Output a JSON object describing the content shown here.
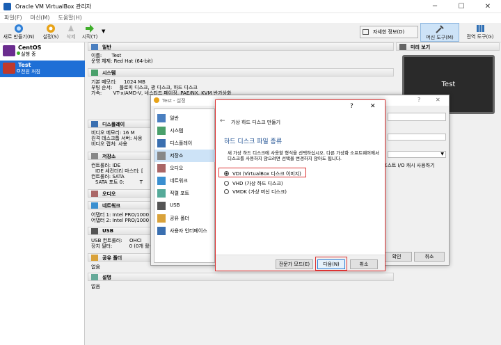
{
  "window": {
    "title": "Oracle VM VirtualBox 관리자"
  },
  "menu": [
    "파일(F)",
    "머신(M)",
    "도움말(H)"
  ],
  "toolbar": {
    "new": "새로 만들기(N)",
    "settings": "설정(S)",
    "discard": "삭제",
    "start": "시작(T)",
    "details": "자세한 정보(D)",
    "machine_tools": "머신 도구(M)",
    "global_tools": "전역 도구(G)"
  },
  "vms": [
    {
      "name": "CentOS",
      "state": "실행 중"
    },
    {
      "name": "Test",
      "state": "전원 꺼짐"
    }
  ],
  "sections": {
    "general": "일반",
    "system": "시스템",
    "display": "디스플레이",
    "storage": "저장소",
    "audio": "오디오",
    "network": "네트워크",
    "usb": "USB",
    "shared": "공유 폴더",
    "desc": "설명",
    "preview": "미리 보기"
  },
  "general": {
    "name_l": "이름:",
    "name_v": "Test",
    "os_l": "운영 체제:",
    "os_v": "Red Hat (64-bit)"
  },
  "system": {
    "r1": "기본 메모리:",
    "r1v": "1024 MB",
    "r2": "부팅 순서:",
    "r2v": "플로피 디스크, 광 디스크, 하드 디스크",
    "r3": "가속:",
    "r3v": "VT-x/AMD-V, 네스티드 페이징, PAE/NX, KVM 반가상화"
  },
  "display": {
    "r1": "비디오 메모리:",
    "r1v": "16 M",
    "r2": "원격 데스크톱 서버:",
    "r2v": "사용",
    "r3": "비디오 캡처:",
    "r3v": "사용"
  },
  "storage": {
    "r1": "컨트롤러: IDE",
    "r2": "IDE 세컨더리 마스터:",
    "r2v": "[",
    "r3": "컨트롤러: SATA",
    "r4": "SATA 포트 0:",
    "r4v": "T"
  },
  "network": {
    "r1": "어댑터 1:",
    "r1v": "Intel PRO/1000",
    "r2": "어댑터 2:",
    "r2v": "Intel PRO/1000"
  },
  "usb": {
    "r1": "USB 컨트롤러:",
    "r1v": "OHCI",
    "r2": "장치 필터:",
    "r2v": "0 (0개 활성"
  },
  "shared": {
    "v": "없음"
  },
  "desc": {
    "v": "없음"
  },
  "preview": {
    "label": "Test"
  },
  "settings_dialog": {
    "title": "Test - 설정",
    "items": [
      "일반",
      "시스템",
      "디스플레이",
      "저장소",
      "오디오",
      "네트워크",
      "직렬 포트",
      "USB",
      "공유 폴더",
      "사용자 인터페이스"
    ],
    "host_cache": "호스트 I/O 캐시 사용하기",
    "ok": "확인",
    "cancel": "취소"
  },
  "wizard": {
    "help": "?",
    "close": "✕",
    "back": "←",
    "title": "가상 하드 디스크 만들기",
    "heading": "하드 디스크 파일 종류",
    "desc": "새 가상 하드 디스크에 사용할 형식을 선택하십시오. 다른 가상화 소프트웨어에서 디스크를 사용하지 않으려면 선택을 변경하지 않아도 됩니다.",
    "options": [
      "VDI (VirtualBox 디스크 이미지)",
      "VHD (가상 하드 디스크)",
      "VMDK (가상 머신 디스크)"
    ],
    "selected": 0,
    "expert": "전문가 모드(E)",
    "next": "다음(N)",
    "cancel": "취소"
  }
}
